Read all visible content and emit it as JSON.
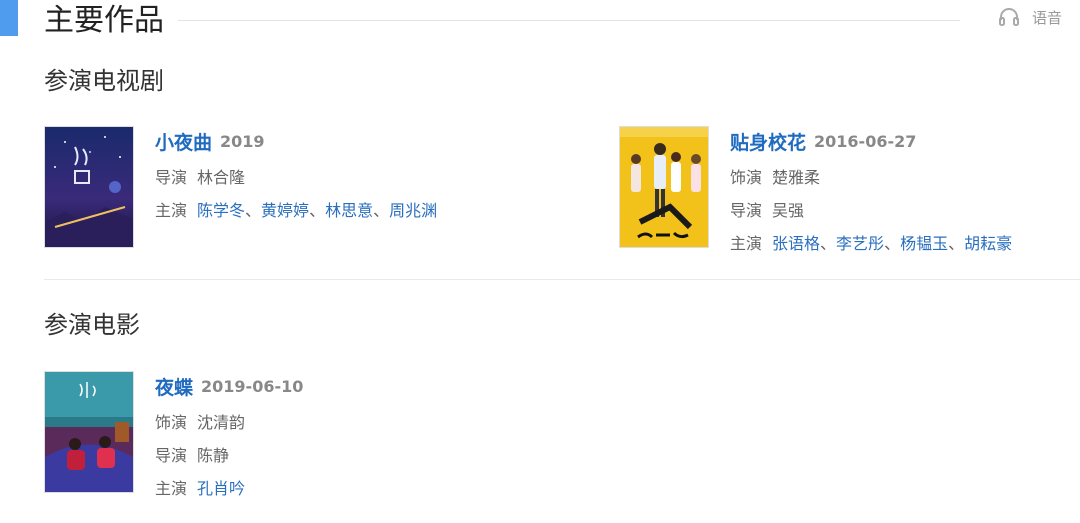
{
  "header": {
    "title": "主要作品",
    "voice_label": "语音"
  },
  "tv_section": {
    "title": "参演电视剧",
    "items": [
      {
        "name": "小夜曲",
        "date": "2019",
        "director_label": "导演",
        "director": "林合隆",
        "cast_label": "主演",
        "cast": [
          "陈学冬",
          "黄婷婷",
          "林思意",
          "周兆渊"
        ]
      },
      {
        "name": "贴身校花",
        "date": "2016-06-27",
        "role_label": "饰演",
        "role": "楚雅柔",
        "director_label": "导演",
        "director": "吴强",
        "cast_label": "主演",
        "cast": [
          "张语格",
          "李艺彤",
          "杨韫玉",
          "胡耘豪"
        ]
      }
    ]
  },
  "film_section": {
    "title": "参演电影",
    "items": [
      {
        "name": "夜蝶",
        "date": "2019-06-10",
        "role_label": "饰演",
        "role": "沈清韵",
        "director_label": "导演",
        "director": "陈静",
        "cast_label": "主演",
        "cast": [
          "孔肖吟"
        ]
      }
    ]
  },
  "separator": "、",
  "colors": {
    "accent": "#4f9cee",
    "link": "#1f6bc0",
    "poster_yellow": "#f2c21a"
  },
  "icons": {
    "voice": "headphones-icon"
  }
}
